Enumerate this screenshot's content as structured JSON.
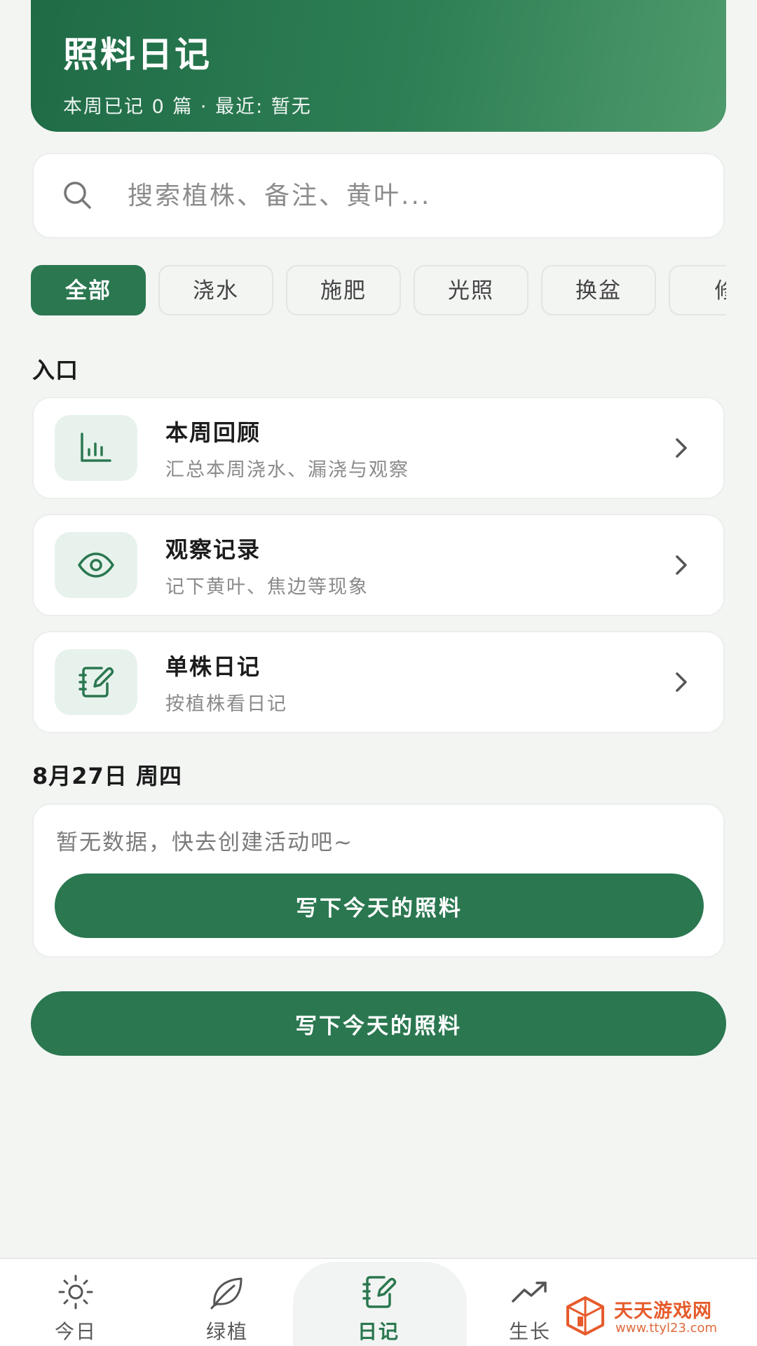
{
  "header": {
    "title": "照料日记",
    "subtitle": "本周已记 0 篇 · 最近: 暂无"
  },
  "search": {
    "placeholder": "搜索植株、备注、黄叶..."
  },
  "filters": [
    {
      "label": "全部",
      "active": true
    },
    {
      "label": "浇水",
      "active": false
    },
    {
      "label": "施肥",
      "active": false
    },
    {
      "label": "光照",
      "active": false
    },
    {
      "label": "换盆",
      "active": false
    },
    {
      "label": "修",
      "active": false
    }
  ],
  "entries_section": {
    "title": "入口",
    "items": [
      {
        "title": "本周回顾",
        "subtitle": "汇总本周浇水、漏浇与观察",
        "icon": "bar-chart-icon"
      },
      {
        "title": "观察记录",
        "subtitle": "记下黄叶、焦边等现象",
        "icon": "eye-icon"
      },
      {
        "title": "单株日记",
        "subtitle": "按植株看日记",
        "icon": "notebook-pen-icon"
      }
    ]
  },
  "day_section": {
    "date": "8月27日 周四",
    "empty_text": "暂无数据，快去创建活动吧~",
    "button_label": "写下今天的照料"
  },
  "primary_button_label": "写下今天的照料",
  "bottom_nav": [
    {
      "label": "今日",
      "icon": "sun-icon",
      "active": false
    },
    {
      "label": "绿植",
      "icon": "leaf-icon",
      "active": false
    },
    {
      "label": "日记",
      "icon": "notebook-pen-icon",
      "active": true
    },
    {
      "label": "生长",
      "icon": "trend-up-icon",
      "active": false
    }
  ],
  "watermark": {
    "name": "天天游戏网",
    "url": "www.ttyl23.com"
  },
  "colors": {
    "primary": "#2a7750",
    "icon_bg": "#e8f2ec",
    "watermark": "#e65b2c"
  }
}
